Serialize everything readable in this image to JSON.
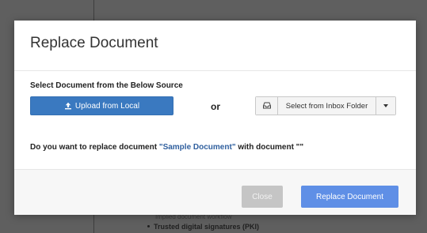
{
  "background": {
    "visible_line_1": "Implied document workflow",
    "visible_line_2": "Trusted digital signatures (PKI)"
  },
  "modal": {
    "title": "Replace Document",
    "source_label": "Select Document from the Below Source",
    "upload_label": "Upload from Local",
    "or_label": "or",
    "inbox_label": "Select from Inbox Folder",
    "question_prefix": "Do you want to replace document ",
    "question_quote_open": "\"",
    "question_docname": "Sample Document",
    "question_quote_close": "\"",
    "question_suffix": " with document \"\"",
    "close_label": "Close",
    "replace_label": "Replace Document"
  },
  "colors": {
    "primary": "#3a79c0",
    "replace_button": "#5f8fe6",
    "close_disabled": "#c5c5c5",
    "doc_name": "#2f5f9e"
  },
  "icons": {
    "upload": "upload-icon",
    "inbox": "inbox-icon",
    "dropdown": "chevron-down-icon"
  }
}
